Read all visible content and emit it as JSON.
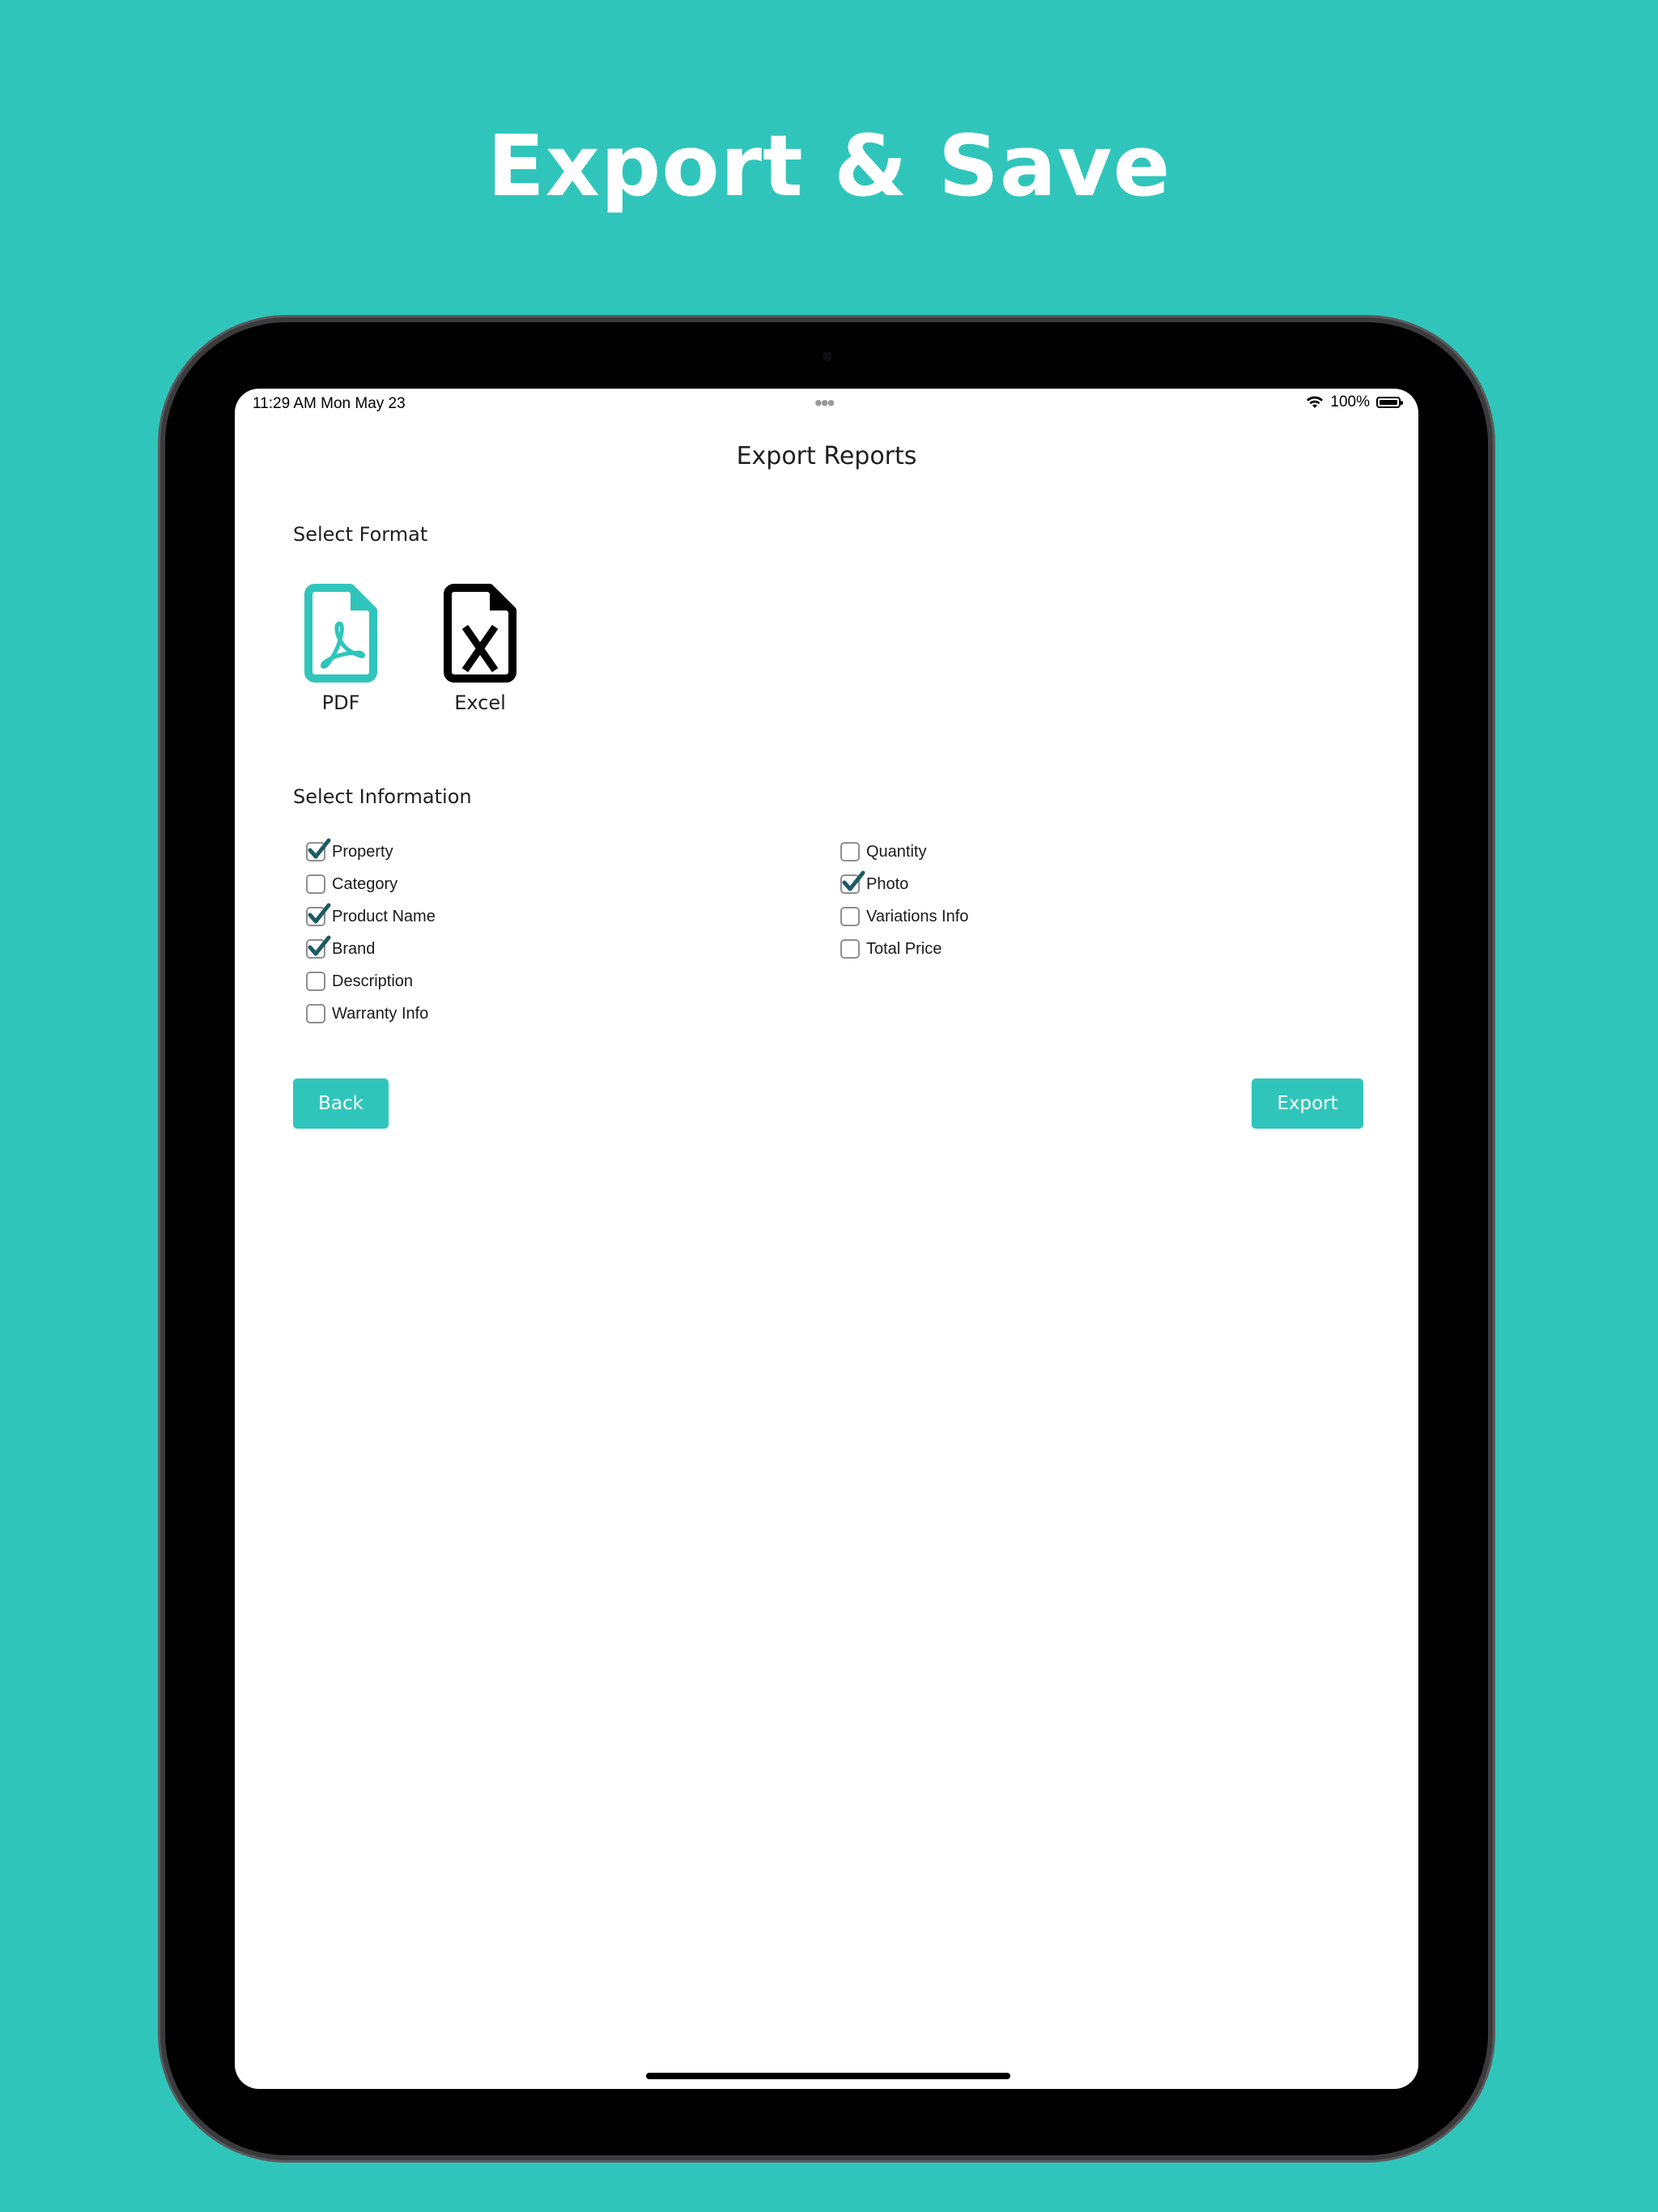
{
  "headline": "Export & Save",
  "status_bar": {
    "time": "11:29 AM   Mon May 23",
    "multitask_dots": "•••",
    "battery": "100%",
    "wifi_icon": "wifi-icon",
    "battery_icon": "battery-icon"
  },
  "screen": {
    "title": "Export Reports",
    "select_format_label": "Select Format",
    "formats": [
      {
        "label": "PDF",
        "icon": "pdf-file-icon",
        "selected": true,
        "color": "#30c5bb"
      },
      {
        "label": "Excel",
        "icon": "excel-file-icon",
        "selected": false,
        "color": "#000000"
      }
    ],
    "select_information_label": "Select Information",
    "options_left": [
      {
        "label": "Property",
        "checked": true
      },
      {
        "label": "Category",
        "checked": false
      },
      {
        "label": "Product Name",
        "checked": true
      },
      {
        "label": "Brand",
        "checked": true
      },
      {
        "label": "Description",
        "checked": false
      },
      {
        "label": "Warranty Info",
        "checked": false
      }
    ],
    "options_right": [
      {
        "label": "Quantity",
        "checked": false
      },
      {
        "label": "Photo",
        "checked": true
      },
      {
        "label": "Variations Info",
        "checked": false
      },
      {
        "label": "Total Price",
        "checked": false
      }
    ],
    "back_label": "Back",
    "export_label": "Export"
  },
  "colors": {
    "accent": "#30c5bb",
    "check": "#1c5a66"
  }
}
